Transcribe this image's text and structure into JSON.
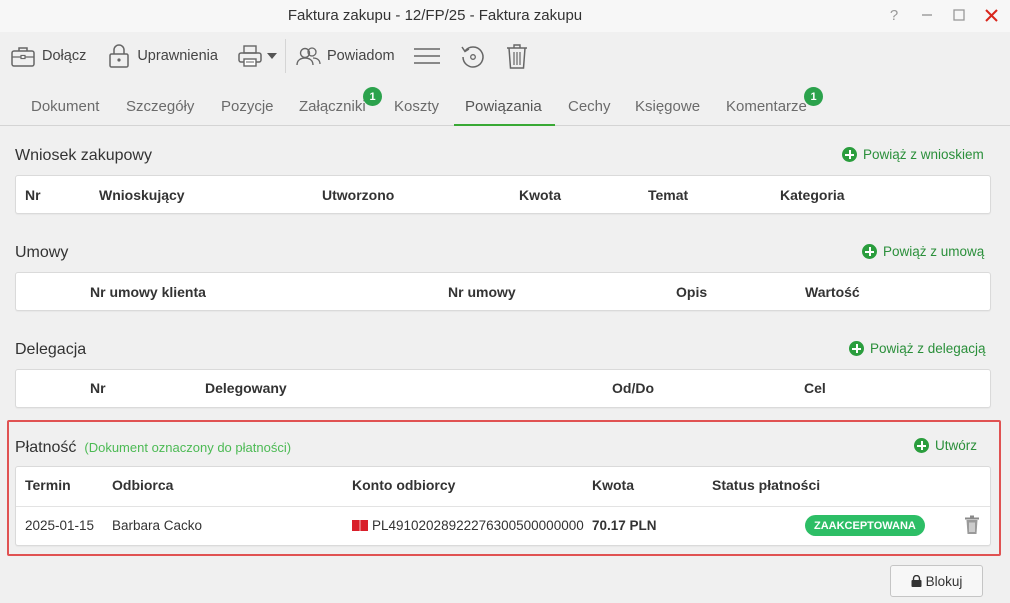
{
  "window": {
    "title": "Faktura zakupu - 12/FP/25 - Faktura zakupu",
    "help": "?",
    "minimize": "—",
    "maximize": "☐",
    "close": "✕"
  },
  "toolbar": {
    "attach": "Dołącz",
    "permissions": "Uprawnienia",
    "notify": "Powiadom"
  },
  "tabs": [
    {
      "label": "Dokument"
    },
    {
      "label": "Szczegóły"
    },
    {
      "label": "Pozycje"
    },
    {
      "label": "Załączniki",
      "badge": "1"
    },
    {
      "label": "Koszty"
    },
    {
      "label": "Powiązania",
      "active": true
    },
    {
      "label": "Cechy"
    },
    {
      "label": "Księgowe"
    },
    {
      "label": "Komentarze",
      "badge": "1"
    }
  ],
  "purchase_request": {
    "title": "Wniosek zakupowy",
    "link": "Powiąż z wnioskiem",
    "columns": [
      "Nr",
      "Wnioskujący",
      "Utworzono",
      "Kwota",
      "Temat",
      "Kategoria"
    ]
  },
  "contracts": {
    "title": "Umowy",
    "link": "Powiąż z umową",
    "columns": [
      "Nr umowy klienta",
      "Nr umowy",
      "Opis",
      "Wartość"
    ]
  },
  "delegation": {
    "title": "Delegacja",
    "link": "Powiąż z delegacją",
    "columns": [
      "Nr",
      "Delegowany",
      "Od/Do",
      "Cel"
    ]
  },
  "payment": {
    "title": "Płatność",
    "note": "(Dokument oznaczony do płatności)",
    "link": "Utwórz",
    "columns": [
      "Termin",
      "Odbiorca",
      "Konto odbiorcy",
      "Kwota",
      "Status płatności"
    ],
    "row": {
      "due": "2025-01-15",
      "recipient": "Barbara Cacko",
      "account": "PL49102028922276300500000000",
      "amount": "70.17 PLN",
      "status": "ZAAKCEPTOWANA"
    }
  },
  "footer": {
    "lock": "Blokuj"
  },
  "colors": {
    "accent": "#39a935",
    "badge": "#2ba24c",
    "status": "#2dbe66",
    "highlight": "#e05252"
  }
}
